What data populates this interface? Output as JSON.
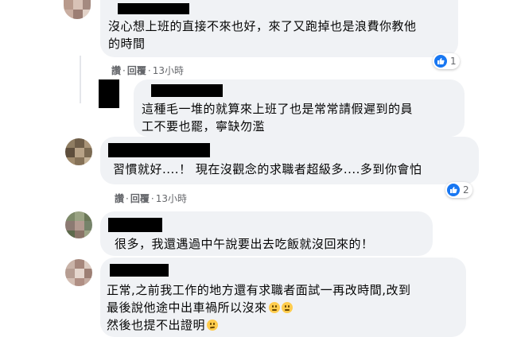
{
  "comments": [
    {
      "text_lines": [
        "沒心想上班的直接不來也好，來了又跑掉也是浪費你教他",
        "的時間"
      ],
      "actions": {
        "like": "讚",
        "reply": "回覆",
        "time": "13小時"
      },
      "reaction_count": "1"
    },
    {
      "text_lines": [
        "這種毛一堆的就算來上班了也是常常請假遲到的員",
        "工不要也罷，寧缺勿濫"
      ]
    },
    {
      "text_lines": [
        "習慣就好....！ 現在沒觀念的求職者超級多....多到你會怕"
      ],
      "actions": {
        "like": "讚",
        "reply": "回覆",
        "time": "13小時"
      },
      "reaction_count": "2"
    },
    {
      "text_lines": [
        "很多，我還遇過中午說要出去吃飯就沒回來的！"
      ]
    },
    {
      "text_lines": [
        "正常,之前我工作的地方還有求職者面試一再改時間,改到",
        "最後說他途中出車禍所以沒來",
        "然後也提不出證明"
      ]
    }
  ],
  "separator": "·",
  "icons": {
    "like": "thumbs-up-icon",
    "emoji_sad": "frowning-face-emoji-icon",
    "emoji_roll": "eye-roll-emoji-icon"
  },
  "colors": {
    "bubble": "#f0f2f5",
    "meta": "#65676b",
    "like_blue": "#1877f2"
  }
}
